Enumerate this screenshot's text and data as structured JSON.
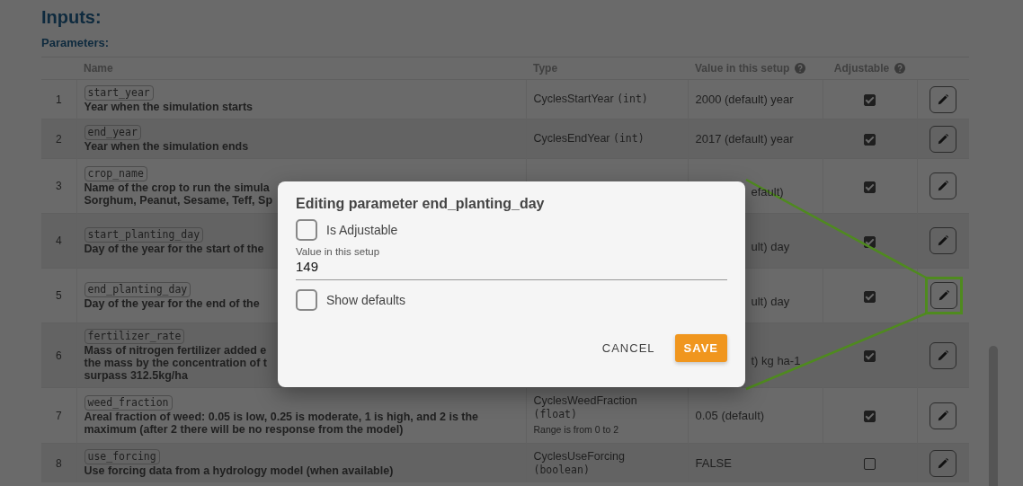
{
  "page": {
    "heading": "Inputs:",
    "subheading": "Parameters:"
  },
  "table": {
    "columns": [
      {
        "label": "Name",
        "help_icon": false
      },
      {
        "label": "Type",
        "help_icon": false
      },
      {
        "label": "Value in this setup",
        "help_icon": true
      },
      {
        "label": "Adjustable",
        "help_icon": true
      }
    ],
    "rows": [
      {
        "index": "1",
        "param": "start_year",
        "description": [
          "Year when the simulation starts"
        ],
        "type": {
          "name": "CyclesStartYear",
          "datatype": "(int)"
        },
        "value": "2000 (default) year",
        "adjustable": true,
        "highlighted": false
      },
      {
        "index": "2",
        "param": "end_year",
        "description": [
          "Year when the simulation ends"
        ],
        "type": {
          "name": "CyclesEndYear",
          "datatype": "(int)"
        },
        "value": "2017 (default) year",
        "adjustable": true,
        "highlighted": false
      },
      {
        "index": "3",
        "param": "crop_name",
        "description": [
          "Name of the crop to run the simula",
          "Sorghum, Peanut, Sesame, Teff, Sp"
        ],
        "value": "efault)",
        "adjustable": true,
        "highlighted": false
      },
      {
        "index": "4",
        "param": "start_planting_day",
        "description": [
          "Day of the year for the start of the"
        ],
        "value": "ult) day",
        "adjustable": true,
        "highlighted": false
      },
      {
        "index": "5",
        "param": "end_planting_day",
        "description": [
          "Day of the year for the end of the"
        ],
        "value": "ult) day",
        "adjustable": true,
        "highlighted": true
      },
      {
        "index": "6",
        "param": "fertilizer_rate",
        "description": [
          "Mass of nitrogen fertilizer added e",
          "the mass by the concentration of t",
          "surpass 312.5kg/ha"
        ],
        "value": "t) kg ha-1",
        "adjustable": true,
        "highlighted": false
      },
      {
        "index": "7",
        "param": "weed_fraction",
        "description": [
          "Areal fraction of weed: 0.05 is low, 0.25 is moderate, 1 is high, and 2 is the",
          "maximum (after 2 there will be no response from the model)"
        ],
        "type": {
          "name": "CyclesWeedFraction",
          "datatype": "(float)",
          "range": "Range is from 0 to 2"
        },
        "value": "0.05 (default)",
        "adjustable": true,
        "highlighted": false
      },
      {
        "index": "8",
        "param": "use_forcing",
        "description": [
          "Use forcing data from a hydrology model (when available)"
        ],
        "type": {
          "name": "CyclesUseForcing",
          "datatype": "(boolean)"
        },
        "value": "FALSE",
        "adjustable": false,
        "highlighted": false
      }
    ]
  },
  "dialog": {
    "title": "Editing parameter end_planting_day",
    "is_adjustable": {
      "label": "Is Adjustable",
      "checked": false
    },
    "value_field": {
      "label": "Value in this setup",
      "value": "149"
    },
    "show_defaults": {
      "label": "Show defaults",
      "checked": false
    },
    "buttons": [
      {
        "label": "CANCEL",
        "kind": "text"
      },
      {
        "label": "SAVE",
        "kind": "primary"
      }
    ]
  }
}
